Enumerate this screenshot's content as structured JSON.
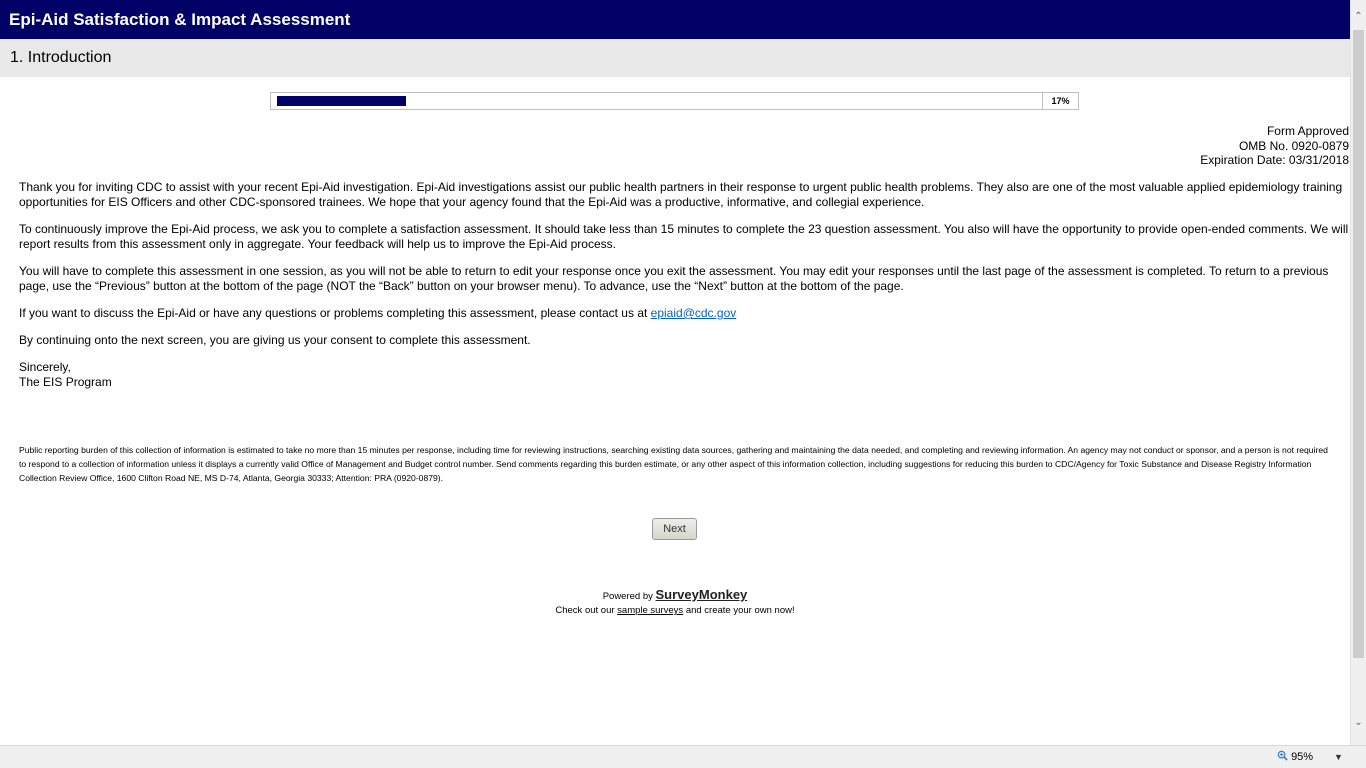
{
  "survey_title": "Epi-Aid Satisfaction & Impact Assessment",
  "page_heading": "1. Introduction",
  "progress": {
    "percent_label": "17%",
    "fraction": 0.17
  },
  "omb": {
    "line1": "Form Approved",
    "line2": "OMB No. 0920-0879",
    "line3": "Expiration Date: 03/31/2018"
  },
  "body": {
    "p1": "Thank you for inviting CDC to assist with your recent Epi-Aid investigation. Epi-Aid investigations assist our public health partners in their response to urgent public health problems. They also are one of the most valuable applied epidemiology training opportunities for EIS Officers and other CDC-sponsored trainees.  We hope that your agency found that the Epi-Aid was a productive, informative, and collegial experience.",
    "p2": "To continuously improve the Epi-Aid process, we ask you to complete a satisfaction assessment. It should take less than 15 minutes to complete the 23 question assessment. You also will have the opportunity to provide open-ended comments. We will report results from this assessment only in aggregate. Your feedback will help us to improve the Epi-Aid process.",
    "p3": "You will have to complete this assessment in one session, as you will not be able to return to edit your response once you exit the assessment. You may edit your responses until the last page of the assessment is completed. To return to a previous page, use the “Previous” button at the bottom of the page (NOT the “Back” button on your browser menu). To advance, use the “Next” button at the bottom of the page.",
    "p4_text": "If you want to discuss the Epi-Aid or have any questions or problems completing this assessment, please contact us at ",
    "p4_link": "epiaid@cdc.gov",
    "p5": "By continuing onto the next screen, you are giving us your consent to complete this assessment.",
    "closing": "Sincerely,",
    "signature": "The EIS Program"
  },
  "disclaimer": "Public reporting burden of this collection of information is estimated to take no more than 15 minutes per response, including time for reviewing instructions, searching existing data sources, gathering and maintaining the data needed, and completing and reviewing information. An agency may not conduct or sponsor, and a person is not required to respond to a collection of information unless it displays a currently valid Office of Management and Budget control number. Send comments regarding this burden estimate, or any other aspect of this information collection, including suggestions for reducing this burden to CDC/Agency for Toxic Substance and Disease Registry Information Collection Review Office, 1600 Clifton Road NE, MS D-74, Atlanta, Georgia 30333; Attention: PRA (0920-0879).",
  "next_button": "Next",
  "footer": {
    "powered_by": "Powered by",
    "brand": "SurveyMonkey",
    "check_out": "Check out our",
    "sample_link": "sample surveys",
    "create": "and create your own now!"
  },
  "status_bar": {
    "zoom": "95%",
    "zoom_icon": "magnifier-icon"
  },
  "colors": {
    "header_bg": "#000066",
    "progress_fill": "#000066",
    "link": "#0563c1"
  }
}
